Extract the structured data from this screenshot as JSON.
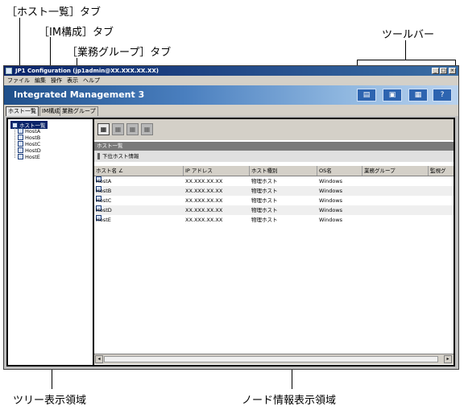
{
  "callouts": {
    "host_tab": "［ホスト一覧］タブ",
    "im_tab": "［IM構成］タブ",
    "business_tab": "［業務グループ］タブ",
    "toolbar": "ツールバー",
    "tree_area": "ツリー表示領域",
    "node_area": "ノード情報表示領域"
  },
  "window": {
    "title": "JP1 Configuration (jp1admin@XX.XXX.XX.XX)",
    "controls": [
      "_",
      "□",
      "×"
    ]
  },
  "menu": [
    "ファイル",
    "編集",
    "操作",
    "表示",
    "ヘルプ"
  ],
  "banner": {
    "title": "Integrated Management 3",
    "toolbar_buttons": [
      "▤",
      "▣",
      "▦",
      "?"
    ]
  },
  "tabs": [
    "ホスト一覧",
    "IM構成",
    "業務グループ"
  ],
  "tree": {
    "root": "ホスト一覧",
    "hosts": [
      "HostA",
      "HostB",
      "HostC",
      "HostD",
      "HostE"
    ]
  },
  "node_panel": {
    "section_title": "ホスト一覧",
    "sub_title": "下位ホスト情報",
    "columns": [
      "ホスト名 ∠",
      "IP アドレス",
      "ホスト種別",
      "OS名",
      "業務グループ",
      "監視グ"
    ],
    "rows": [
      {
        "host": "HostA",
        "ip": "XX.XXX.XX.XX",
        "type": "物理ホスト",
        "os": "Windows"
      },
      {
        "host": "HostB",
        "ip": "XX.XXX.XX.XX",
        "type": "物理ホスト",
        "os": "Windows"
      },
      {
        "host": "HostC",
        "ip": "XX.XXX.XX.XX",
        "type": "物理ホスト",
        "os": "Windows"
      },
      {
        "host": "HostD",
        "ip": "XX.XXX.XX.XX",
        "type": "物理ホスト",
        "os": "Windows"
      },
      {
        "host": "HostE",
        "ip": "XX.XXX.XX.XX",
        "type": "物理ホスト",
        "os": "Windows"
      }
    ],
    "scroll": {
      "left": "◂",
      "right": "▸"
    }
  }
}
